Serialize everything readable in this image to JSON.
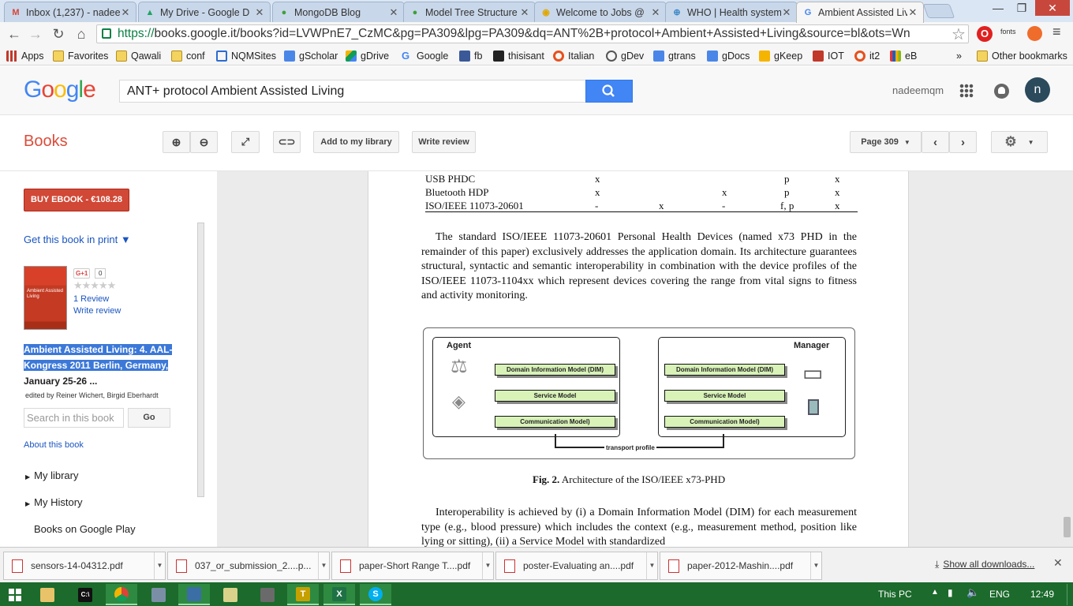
{
  "tabs": [
    {
      "title": "Inbox (1,237) - nadee",
      "icon": "gmail-icon",
      "color": "#d44638",
      "glyph": "M"
    },
    {
      "title": "My Drive - Google D",
      "icon": "drive-icon",
      "color": "#1fa463",
      "glyph": "▲"
    },
    {
      "title": "MongoDB Blog",
      "icon": "mongodb-icon",
      "color": "#3fa037",
      "glyph": "●"
    },
    {
      "title": "Model Tree Structure",
      "icon": "mongodb-icon",
      "color": "#3fa037",
      "glyph": "●"
    },
    {
      "title": "Welcome to Jobs @",
      "icon": "jobs-icon",
      "color": "#e0a800",
      "glyph": "◉"
    },
    {
      "title": "WHO | Health system",
      "icon": "who-icon",
      "color": "#3a87c8",
      "glyph": "⊕"
    },
    {
      "title": "Ambient Assisted Liv",
      "icon": "google-icon",
      "color": "#4285f4",
      "glyph": "G"
    }
  ],
  "address": {
    "scheme": "https://",
    "rest": "books.google.it/books?id=LVWPnE7_CzMC&pg=PA309&lpg=PA309&dq=ANT%2B+protocol+Ambient+Assisted+Living&source=bl&ots=Wn"
  },
  "toolbar_ext_label": "fonts",
  "bookmarks": [
    {
      "label": "Apps",
      "icon": "apps-icon",
      "kind": "apps"
    },
    {
      "label": "Favorites",
      "icon": "folder-icon",
      "kind": "folder"
    },
    {
      "label": "Qawali",
      "icon": "folder-icon",
      "kind": "folder"
    },
    {
      "label": "conf",
      "icon": "folder-icon",
      "kind": "folder"
    },
    {
      "label": "NQMSites",
      "icon": "nqm-icon",
      "kind": "site",
      "color": "#2b6cd4"
    },
    {
      "label": "gScholar",
      "icon": "scholar-icon",
      "kind": "site",
      "color": "#4a86e8"
    },
    {
      "label": "gDrive",
      "icon": "drive-icon",
      "kind": "site",
      "color": "#1fa463"
    },
    {
      "label": "Google",
      "icon": "google-icon",
      "kind": "site",
      "color": "#4285f4"
    },
    {
      "label": "fb",
      "icon": "facebook-icon",
      "kind": "site",
      "color": "#3b5998"
    },
    {
      "label": "thisisant",
      "icon": "ant-icon",
      "kind": "site",
      "color": "#222222"
    },
    {
      "label": "Italian",
      "icon": "italian-icon",
      "kind": "site",
      "color": "#e8501c"
    },
    {
      "label": "gDev",
      "icon": "gdev-icon",
      "kind": "site",
      "color": "#555555"
    },
    {
      "label": "gtrans",
      "icon": "translate-icon",
      "kind": "site",
      "color": "#4a86e8"
    },
    {
      "label": "gDocs",
      "icon": "docs-icon",
      "kind": "site",
      "color": "#4a86e8"
    },
    {
      "label": "gKeep",
      "icon": "keep-icon",
      "kind": "site",
      "color": "#f5b400"
    },
    {
      "label": "IOT",
      "icon": "iot-icon",
      "kind": "site",
      "color": "#c0392b"
    },
    {
      "label": "it2",
      "icon": "it2-icon",
      "kind": "site",
      "color": "#e8501c"
    },
    {
      "label": "eB",
      "icon": "ebay-icon",
      "kind": "site",
      "color": "#e53238"
    }
  ],
  "bookmarks_overflow": "»",
  "other_bookmarks": "Other bookmarks",
  "google": {
    "search_value": "ANT+ protocol Ambient Assisted Living",
    "username": "nadeemqm",
    "avatar_letter": "n"
  },
  "books_bar": {
    "brand": "Books",
    "add_library": "Add to my library",
    "write_review": "Write review",
    "page_label": "Page 309"
  },
  "sidebar": {
    "buy_ebook": "BUY EBOOK - €108.28",
    "get_print": "Get this book in print ▼",
    "gplus_label": "G+1",
    "gplus_count": "0",
    "reviews_count": "1 Review",
    "write_review": "Write review",
    "book_title": "Ambient Assisted Living: 4. AAL-Kongress 2011 Berlin, Germany,",
    "book_title_dates": "January 25-26 ...",
    "editors": "edited by Reiner Wichert, Birgid Eberhardt",
    "search_placeholder": "Search in this book",
    "go_label": "Go",
    "about": "About this book",
    "my_library": "My library",
    "my_history": "My History",
    "play": "Books on Google Play",
    "cover_title": "Ambient Assisted Living"
  },
  "page_content": {
    "table_rows": [
      {
        "name": "USB PHDC",
        "c1": "x",
        "c2": "",
        "c3": "",
        "c4": "p",
        "c5": "x"
      },
      {
        "name": "Bluetooth HDP",
        "c1": "x",
        "c2": "",
        "c3": "x",
        "c4": "p",
        "c5": "x"
      },
      {
        "name": "ISO/IEEE 11073-20601",
        "c1": "-",
        "c2": "x",
        "c3": "-",
        "c4": "f, p",
        "c5": "x"
      }
    ],
    "para1": "The standard ISO/IEEE 11073-20601 Personal Health Devices (named x73 PHD in the remainder of this paper) exclusively addresses the application domain. Its architecture guarantees structural, syntactic and semantic interoperability in combination with the device profiles of the ISO/IEEE 11073-1104xx which represent devices covering the range from vital signs to fitness and activity monitoring.",
    "figure": {
      "agent": "Agent",
      "manager": "Manager",
      "dim": "Domain Information Model (DIM)",
      "service": "Service Model",
      "comm": "Communication Model)",
      "transport": "transport profile"
    },
    "caption_bold": "Fig. 2.",
    "caption_text": "Architecture of the ISO/IEEE x73-PHD",
    "para2": "Interoperability is achieved by (i) a Domain Information Model (DIM) for each measurement type (e.g., blood pressure) which includes the context (e.g., measurement method, position like lying or sitting), (ii) a Service Model with standardized"
  },
  "downloads": [
    "sensors-14-04312.pdf",
    "037_or_submission_2....p...",
    "paper-Short Range T....pdf",
    "poster-Evaluating an....pdf",
    "paper-2012-Mashin....pdf"
  ],
  "show_all_downloads": "Show all downloads...",
  "taskbar": {
    "this_pc": "This PC",
    "lang": "ENG",
    "time": "12:49",
    "apps": [
      {
        "icon": "file-explorer-icon",
        "glyph": "▬",
        "color": "#e8c36a"
      },
      {
        "icon": "cmd-icon",
        "glyph": "C:\\",
        "color": "#111111"
      },
      {
        "icon": "chrome-icon",
        "glyph": "◉",
        "color": "#db4437"
      },
      {
        "icon": "calculator-icon",
        "glyph": "▦",
        "color": "#7a8fa6"
      },
      {
        "icon": "remote-desktop-icon",
        "glyph": "▣",
        "color": "#3a6ea5"
      },
      {
        "icon": "notepad-icon",
        "glyph": "✎",
        "color": "#d9d28a"
      },
      {
        "icon": "tool-icon",
        "glyph": "▤",
        "color": "#6a6a6a"
      },
      {
        "icon": "texstudio-icon",
        "glyph": "T",
        "color": "#c5a000"
      },
      {
        "icon": "excel-icon",
        "glyph": "X",
        "color": "#1e7145"
      },
      {
        "icon": "skype-icon",
        "glyph": "S",
        "color": "#00aff0"
      }
    ]
  }
}
